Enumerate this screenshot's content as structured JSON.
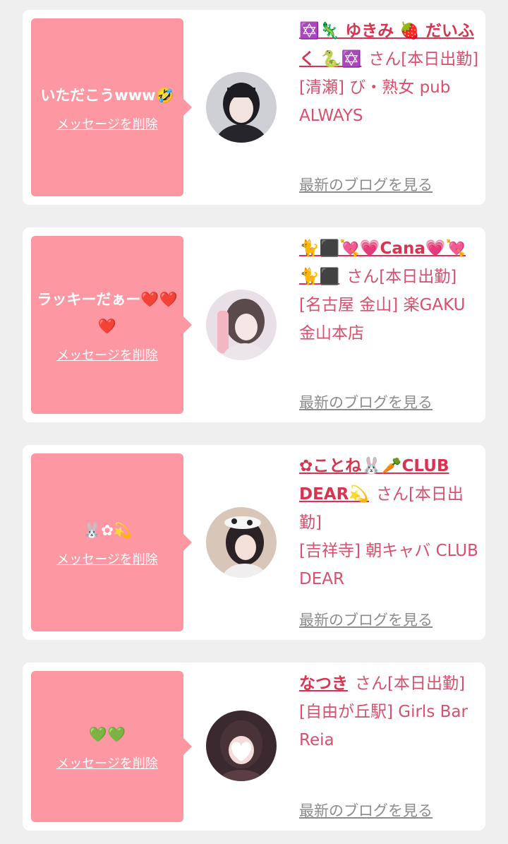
{
  "cards": [
    {
      "message": "いただこうwww🤣",
      "delete_label": "メッセージを削除",
      "cast_name": "✡️🦎 ゆきみ 🍓 だいふく 🐍✡️",
      "suffix": "さん[本日出勤]",
      "shop": "[清瀬] び・熟女 pub ALWAYS",
      "blog_link": "最新のブログを見る"
    },
    {
      "message": "ラッキーだぁー❤️❤️❤️",
      "delete_label": "メッセージを削除",
      "cast_name": "🐈⬛💘💗Cana💗💘🐈⬛",
      "suffix": "さん[本日出勤]",
      "shop": "[名古屋 金山] 楽GAKU 金山本店",
      "blog_link": "最新のブログを見る"
    },
    {
      "message": "🐰✿💫",
      "delete_label": "メッセージを削除",
      "cast_name": "✿ことね🐰🥕CLUB DEAR💫",
      "suffix": "さん[本日出勤]",
      "shop": "[吉祥寺] 朝キャバ CLUB DEAR",
      "blog_link": "最新のブログを見る"
    },
    {
      "message": "💚💚",
      "delete_label": "メッセージを削除",
      "cast_name": "なつき",
      "suffix": "さん[本日出勤]",
      "shop": "[自由が丘駅] Girls Bar Reia",
      "blog_link": "最新のブログを見る"
    }
  ]
}
